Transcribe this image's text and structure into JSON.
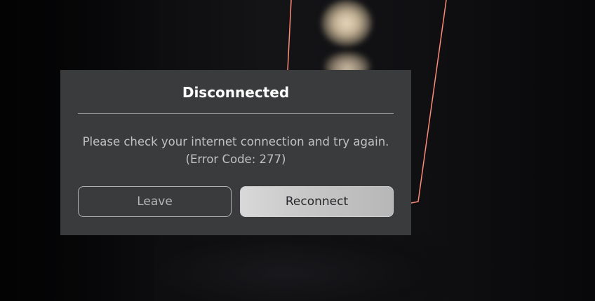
{
  "dialog": {
    "title": "Disconnected",
    "message_line1": "Please check your internet connection and try again.",
    "message_line2": "(Error Code: 277)",
    "leave_label": "Leave",
    "reconnect_label": "Reconnect"
  },
  "colors": {
    "dialog_bg": "#393b3d",
    "title_text": "#ffffff",
    "body_text": "#bfc1c3",
    "reconnect_bg": "#c8c8c8",
    "selection_outline": "#ff8a7a"
  },
  "icons": [
    "game-world-background"
  ]
}
